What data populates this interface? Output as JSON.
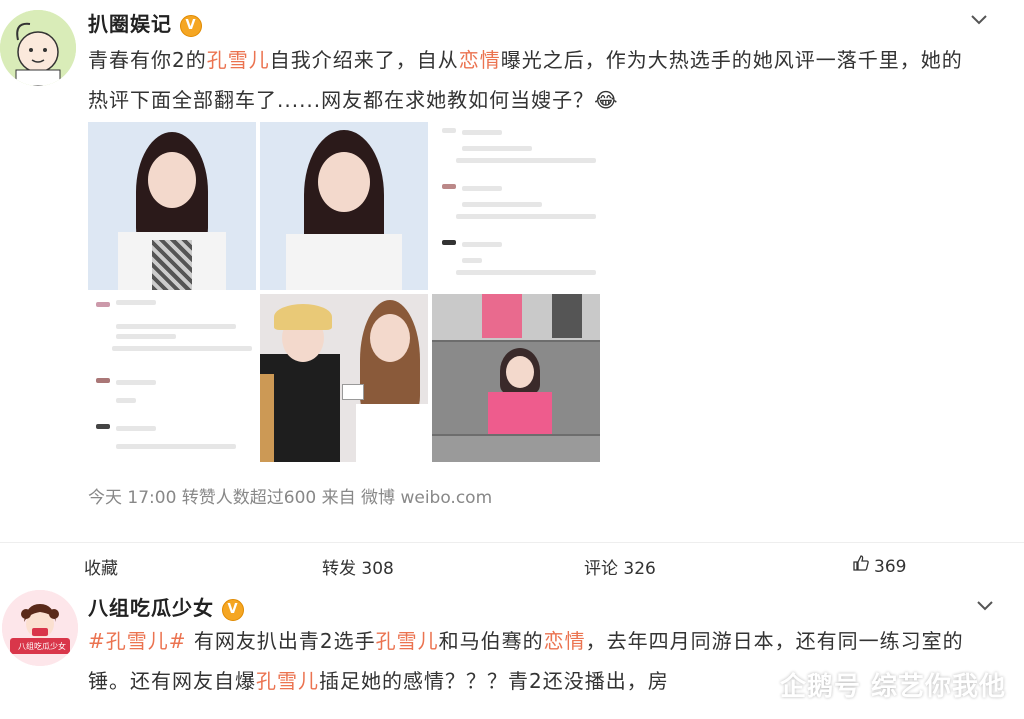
{
  "post1": {
    "username": "扒圈娱记",
    "verified_badge": "V",
    "text_parts": [
      "青春有你2的",
      "孔雪儿",
      "自我介绍来了，自从",
      "恋情",
      "曝光之后，作为大热选手的她风评一落千里，她的热评下面全部翻车了......网友都在求她教如何当嫂子？"
    ],
    "emoji": "😂",
    "meta": "今天 17:00 转赞人数超过600  来自 微博 weibo.com",
    "actions": {
      "collect": "收藏",
      "repost": "转发 308",
      "comment": "评论 326",
      "like": "369"
    },
    "icons": {
      "chevron": "chevron-down-icon",
      "like": "thumbs-up-icon"
    }
  },
  "post2": {
    "username": "八组吃瓜少女",
    "verified_badge": "V",
    "avatar_text": "八组吃瓜少女",
    "text_parts": [
      "#孔雪儿#",
      " 有网友扒出青2选手",
      "孔雪儿",
      "和马伯骞的",
      "恋情",
      "，去年四月同游日本，还有同一练习室的锤。还有网友自爆",
      "孔雪儿",
      "插足她的感情？？？青2还没播出，房"
    ],
    "watermark": "企鹅号 综艺你我他"
  },
  "colors": {
    "highlight": "#eb7350",
    "badge": "#f5a623",
    "meta": "#888888"
  }
}
